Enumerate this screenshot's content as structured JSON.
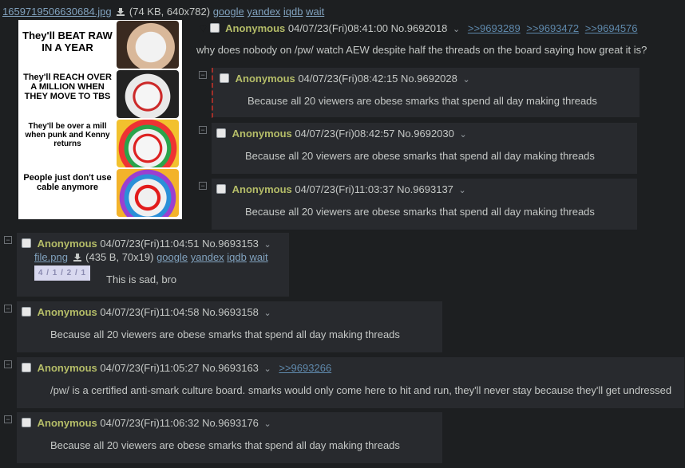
{
  "op": {
    "file_name": "1659719506630684.jpg",
    "file_info": "(74 KB, 640x782)",
    "links": [
      "google",
      "yandex",
      "iqdb",
      "wait"
    ],
    "name": "Anonymous",
    "date": "04/07/23(Fri)08:41:00",
    "no": "No.9692018",
    "backlinks": [
      ">>9693289",
      ">>9693472",
      ">>9694576"
    ],
    "text": "why does nobody on /pw/ watch AEW despite half the threads on the board saying how great it is?",
    "meme": {
      "panels": [
        {
          "text": "They'll  BEAT RAW IN A YEAR"
        },
        {
          "text": "They'll REACH OVER A MILLION WHEN THEY MOVE TO TBS"
        },
        {
          "text": "They'll be over a mill when punk and Kenny returns"
        },
        {
          "text": "People just don't use cable anymore"
        }
      ]
    }
  },
  "replies": [
    {
      "name": "Anonymous",
      "date": "04/07/23(Fri)08:42:15",
      "no": "No.9692028",
      "text": "Because all 20 viewers are obese smarks that spend all day making threads"
    },
    {
      "name": "Anonymous",
      "date": "04/07/23(Fri)08:42:57",
      "no": "No.9692030",
      "text": "Because all 20 viewers are obese smarks that spend all day making threads"
    },
    {
      "name": "Anonymous",
      "date": "04/07/23(Fri)11:03:37",
      "no": "No.9693137",
      "text": "Because all 20 viewers are obese smarks that spend all day making threads"
    },
    {
      "name": "Anonymous",
      "date": "04/07/23(Fri)11:04:51",
      "no": "No.9693153",
      "text": "This is sad, bro",
      "file_name": "file.png",
      "file_info": "(435 B, 70x19)",
      "links": [
        "google",
        "yandex",
        "iqdb",
        "wait"
      ],
      "thumb_text": "4 / 1 / 2 / 1"
    },
    {
      "name": "Anonymous",
      "date": "04/07/23(Fri)11:04:58",
      "no": "No.9693158",
      "text": "Because all 20 viewers are obese smarks that spend all day making threads"
    },
    {
      "name": "Anonymous",
      "date": "04/07/23(Fri)11:05:27",
      "no": "No.9693163",
      "backlink": ">>9693266",
      "text": "/pw/ is a certified anti-smark culture board. smarks would only come here to hit and run, they'll never stay because they'll get undressed"
    },
    {
      "name": "Anonymous",
      "date": "04/07/23(Fri)11:06:32",
      "no": "No.9693176",
      "text": "Because all 20 viewers are obese smarks that spend all day making threads"
    }
  ],
  "colors": {
    "name": "#b5bd68",
    "link": "#81a2be",
    "post_bg": "#282a2e",
    "page_bg": "#1d1f21"
  },
  "icons": [
    "download-icon",
    "heart-icon",
    "checkbox",
    "minus-toggle-icon",
    "chevron-down-icon"
  ]
}
